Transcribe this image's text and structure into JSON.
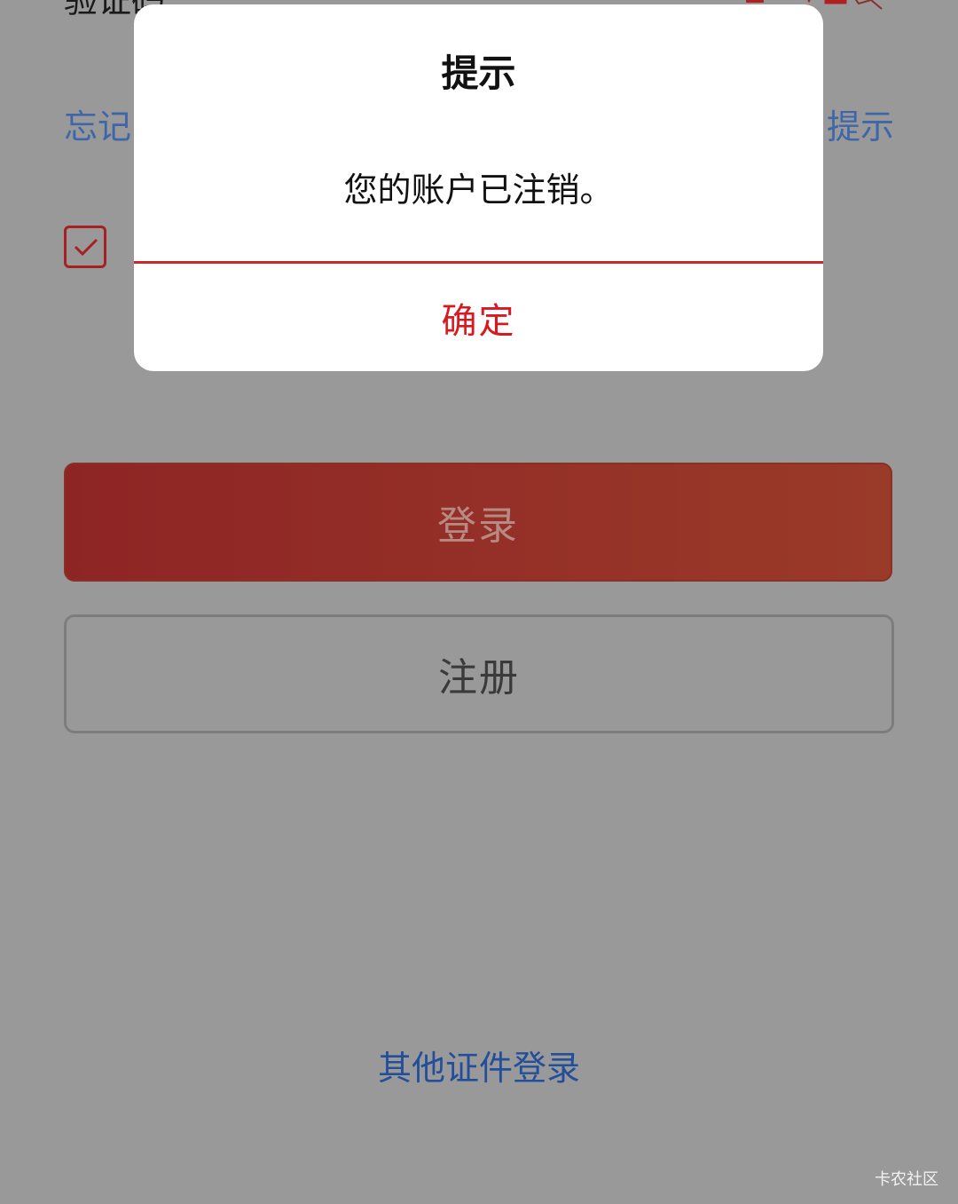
{
  "login_page": {
    "captcha_label": "验证码",
    "captcha_value": "",
    "forgot_link": "忘记",
    "right_link": "提示",
    "agreement_text": "",
    "login_button": "登录",
    "register_button": "注册",
    "other_login_link": "其他证件登录",
    "agreement_checked": true
  },
  "dialog": {
    "title": "提示",
    "message": "您的账户已注销。",
    "confirm_label": "确定"
  },
  "watermark": "卡农社区",
  "colors": {
    "overlay": "#999999",
    "accent_red": "#d8191f",
    "link_blue": "#3f66a8",
    "login_button": "#8e2525"
  }
}
